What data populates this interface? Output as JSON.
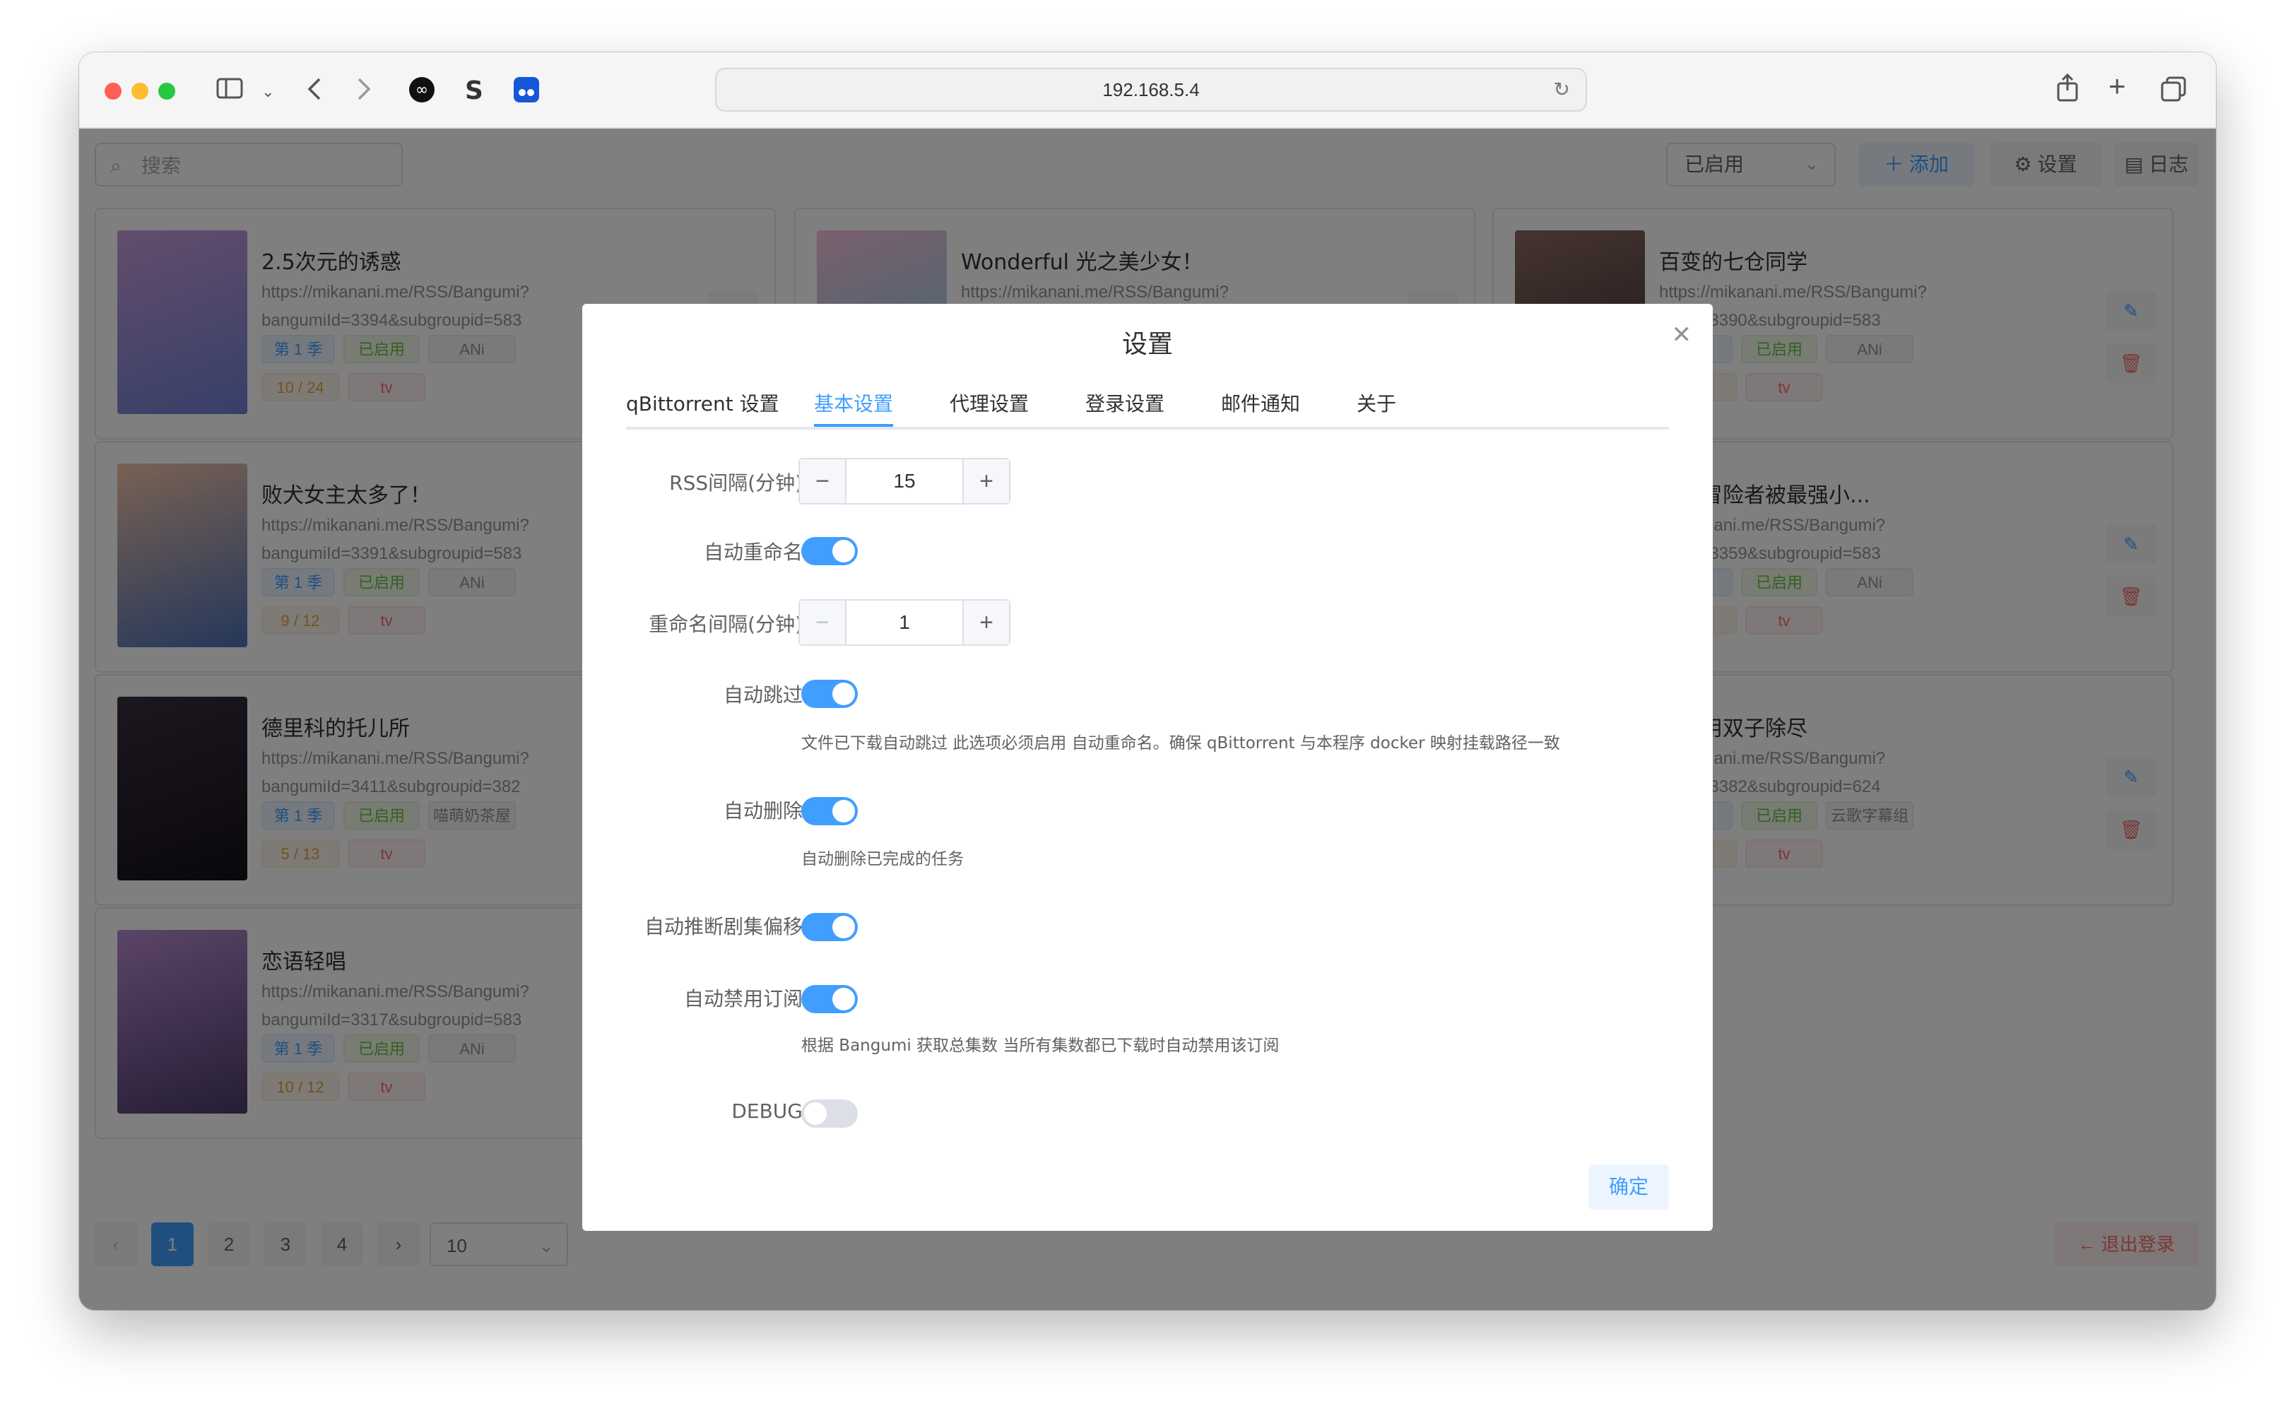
{
  "browser": {
    "url": "192.168.5.4"
  },
  "topbar": {
    "search_placeholder": "搜索",
    "filter_value": "已启用",
    "add_label": "添加",
    "settings_label": "设置",
    "log_label": "日志"
  },
  "cards": [
    {
      "title": "2.5次元的诱惑",
      "url1": "https://mikanani.me/RSS/Bangumi?",
      "url2": "bangumiId=3394&subgroupid=583",
      "season": "第 1 季",
      "status": "已启用",
      "group": "ANi",
      "progress": "10 / 24",
      "type": "tv"
    },
    {
      "title": "Wonderful 光之美少女！",
      "url1": "https://mikanani.me/RSS/Bangumi?",
      "url2": "",
      "season": "",
      "status": "",
      "group": "",
      "progress": "",
      "type": ""
    },
    {
      "title": "百变的七仓同学",
      "url1": "https://mikanani.me/RSS/Bangumi?",
      "url2": "umild=3390&subgroupid=583",
      "season": "季",
      "status": "已启用",
      "group": "ANi",
      "progress": "12",
      "type": "tv"
    },
    {
      "title": "败犬女主太多了！",
      "url1": "https://mikanani.me/RSS/Bangumi?",
      "url2": "bangumiId=3391&subgroupid=583",
      "season": "第 1 季",
      "status": "已启用",
      "group": "ANi",
      "progress": "9 / 12",
      "type": "tv"
    },
    {
      "title": "新人冒险者被最强小...",
      "url1": "//mikanani.me/RSS/Bangumi?",
      "url2": "umild=3359&subgroupid=583",
      "season": "季",
      "status": "已启用",
      "group": "ANi",
      "progress": "12",
      "type": "tv"
    },
    {
      "title": "德里科的托儿所",
      "url1": "https://mikanani.me/RSS/Bangumi?",
      "url2": "bangumiId=3411&subgroupid=382",
      "season": "第 1 季",
      "status": "已启用",
      "group": "喵萌奶茶屋",
      "progress": "5 / 13",
      "type": "tv"
    },
    {
      "title": "没法用双子除尽",
      "url1": "//mikanani.me/RSS/Bangumi?",
      "url2": "umild=3382&subgroupid=624",
      "season": "季",
      "status": "已启用",
      "group": "云歌字幕组",
      "progress": "12",
      "type": "tv"
    },
    {
      "title": "恋语轻唱",
      "url1": "https://mikanani.me/RSS/Bangumi?",
      "url2": "bangumiId=3317&subgroupid=583",
      "season": "第 1 季",
      "status": "已启用",
      "group": "ANi",
      "progress": "10 / 12",
      "type": "tv"
    }
  ],
  "pagination": {
    "pages": [
      "1",
      "2",
      "3",
      "4"
    ],
    "page_size": "10",
    "logout_label": "退出登录"
  },
  "dialog": {
    "title": "设置",
    "tabs": [
      "qBittorrent 设置",
      "基本设置",
      "代理设置",
      "登录设置",
      "邮件通知",
      "关于"
    ],
    "active_tab": "基本设置",
    "rss_interval_label": "RSS间隔(分钟)",
    "rss_interval_value": "15",
    "auto_rename_label": "自动重命名",
    "auto_rename": true,
    "rename_interval_label": "重命名间隔(分钟)",
    "rename_interval_value": "1",
    "auto_skip_label": "自动跳过",
    "auto_skip": true,
    "auto_skip_help": "文件已下载自动跳过 此选项必须启用 自动重命名。确保 qBittorrent 与本程序 docker 映射挂载路径一致",
    "auto_delete_label": "自动删除",
    "auto_delete": true,
    "auto_delete_help": "自动删除已完成的任务",
    "auto_offset_label": "自动推断剧集偏移",
    "auto_offset": true,
    "auto_disable_label": "自动禁用订阅",
    "auto_disable": true,
    "auto_disable_help": "根据 Bangumi 获取总集数 当所有集数都已下载时自动禁用该订阅",
    "debug_label": "DEBUG",
    "debug": false,
    "confirm_label": "确定"
  },
  "colors": {
    "accent": "#409eff",
    "danger": "#f56c6c"
  }
}
